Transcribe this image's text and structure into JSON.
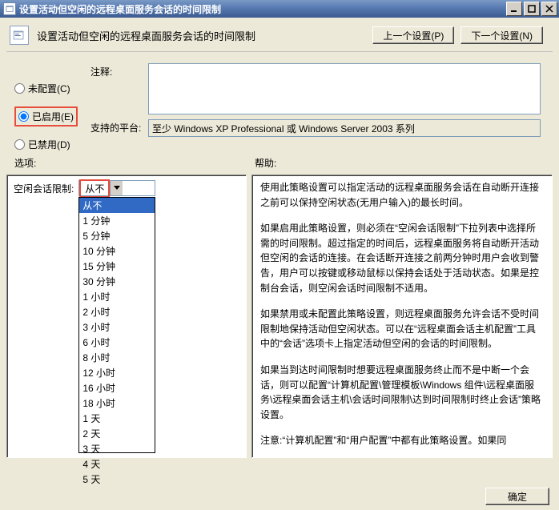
{
  "window": {
    "title": "设置活动但空闲的远程桌面服务会话的时间限制"
  },
  "header": {
    "title": "设置活动但空闲的远程桌面服务会话的时间限制",
    "prev": "上一个设置(P)",
    "next": "下一个设置(N)"
  },
  "radios": {
    "not_configured": "未配置(C)",
    "enabled": "已启用(E)",
    "disabled": "已禁用(D)"
  },
  "labels": {
    "comment": "注释:",
    "supported_on": "支持的平台:",
    "supported_value": "至少 Windows XP Professional 或 Windows Server 2003 系列",
    "options": "选项:",
    "help": "帮助:"
  },
  "option_row": {
    "label": "空闲会话限制:",
    "value": "从不"
  },
  "dropdown_options": [
    "从不",
    "1 分钟",
    "5 分钟",
    "10 分钟",
    "15 分钟",
    "30 分钟",
    "1 小时",
    "2 小时",
    "3 小时",
    "6 小时",
    "8 小时",
    "12 小时",
    "16 小时",
    "18 小时",
    "1 天",
    "2 天",
    "3 天",
    "4 天",
    "5 天"
  ],
  "help_paragraphs": [
    "使用此策略设置可以指定活动的远程桌面服务会话在自动断开连接之前可以保持空闲状态(无用户输入)的最长时间。",
    "如果启用此策略设置，则必须在“空闲会话限制”下拉列表中选择所需的时间限制。超过指定的时间后，远程桌面服务将自动断开活动但空闲的会话的连接。在会话断开连接之前两分钟时用户会收到警告，用户可以按键或移动鼠标以保持会话处于活动状态。如果是控制台会话，则空闲会话时间限制不适用。",
    "如果禁用或未配置此策略设置，则远程桌面服务允许会话不受时间限制地保持活动但空闲状态。可以在“远程桌面会话主机配置”工具中的“会话”选项卡上指定活动但空闲的会话的时间限制。",
    "如果当到达时间限制时想要远程桌面服务终止而不是中断一个会话，则可以配置“计算机配置\\管理模板\\Windows 组件\\远程桌面服务\\远程桌面会话主机\\会话时间限制\\达到时间限制时终止会话”策略设置。",
    "注意:“计算机配置”和“用户配置”中都有此策略设置。如果同"
  ],
  "footer": {
    "ok": "确定"
  }
}
